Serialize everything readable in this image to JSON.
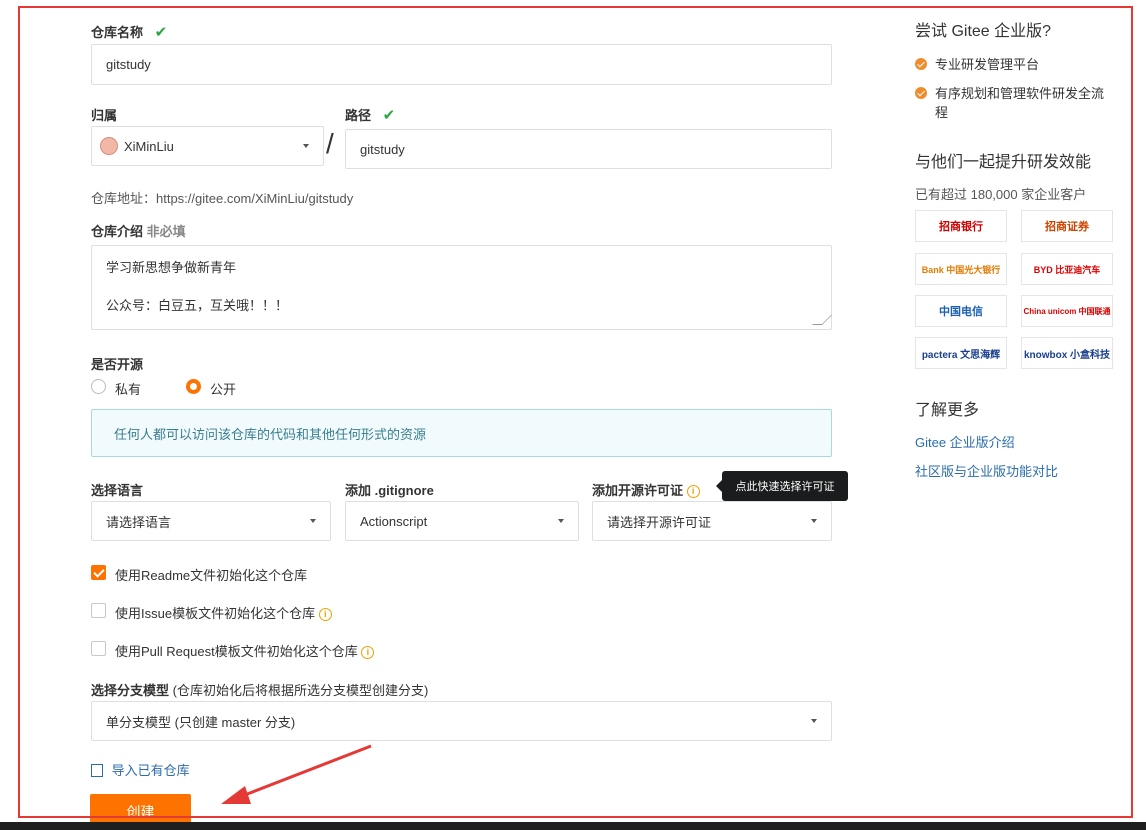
{
  "form": {
    "repo_name_label": "仓库名称",
    "check_mark": "✔",
    "repo_name_value": "gitstudy",
    "owner_label": "归属",
    "path_label": "路径",
    "owner_value": "XiMinLiu",
    "slash": "/",
    "path_value": "gitstudy",
    "repo_address": "仓库地址：https://gitee.com/XiMinLiu/gitstudy",
    "desc_label": "仓库介绍",
    "desc_optional": "非必填",
    "desc_value": "学习新思想争做新青年\n\n公众号：白豆五，互关哦！！！",
    "open_source_label": "是否开源",
    "radio_private": "私有",
    "radio_public": "公开",
    "public_hint": "任何人都可以访问该仓库的代码和其他任何形式的资源",
    "language_label": "选择语言",
    "language_value": "请选择语言",
    "gitignore_label": "添加 .gitignore",
    "gitignore_value": "Actionscript",
    "license_label": "添加开源许可证",
    "license_value": "请选择开源许可证",
    "tooltip": "点此快速选择许可证",
    "info_glyph": "i",
    "init_readme": "使用Readme文件初始化这个仓库",
    "init_issue": "使用Issue模板文件初始化这个仓库",
    "init_pr": "使用Pull Request模板文件初始化这个仓库",
    "branch_label": "选择分支模型",
    "branch_hint": "(仓库初始化后将根据所选分支模型创建分支)",
    "branch_value": "单分支模型 (只创建 master 分支)",
    "import_link": "导入已有仓库",
    "create_button": "创建"
  },
  "sidebar": {
    "try_title": "尝试 Gitee 企业版?",
    "features": [
      "专业研发管理平台",
      "有序规划和管理软件研发全流程"
    ],
    "together_title": "与他们一起提升研发效能",
    "customers": "已有超过 180,000 家企业客户",
    "logos": [
      "招商银行",
      "招商证券",
      "Bank 中国光大银行",
      "BYD 比亚迪汽车",
      "中国电信",
      "China unicom 中国联通",
      "pactera 文思海辉",
      "knowbox 小盒科技"
    ],
    "more_title": "了解更多",
    "links": [
      "Gitee 企业版介绍",
      "社区版与企业版功能对比"
    ]
  },
  "colors": {
    "accent": "#fe7300",
    "annotation": "#e53935",
    "success": "#28a745"
  }
}
